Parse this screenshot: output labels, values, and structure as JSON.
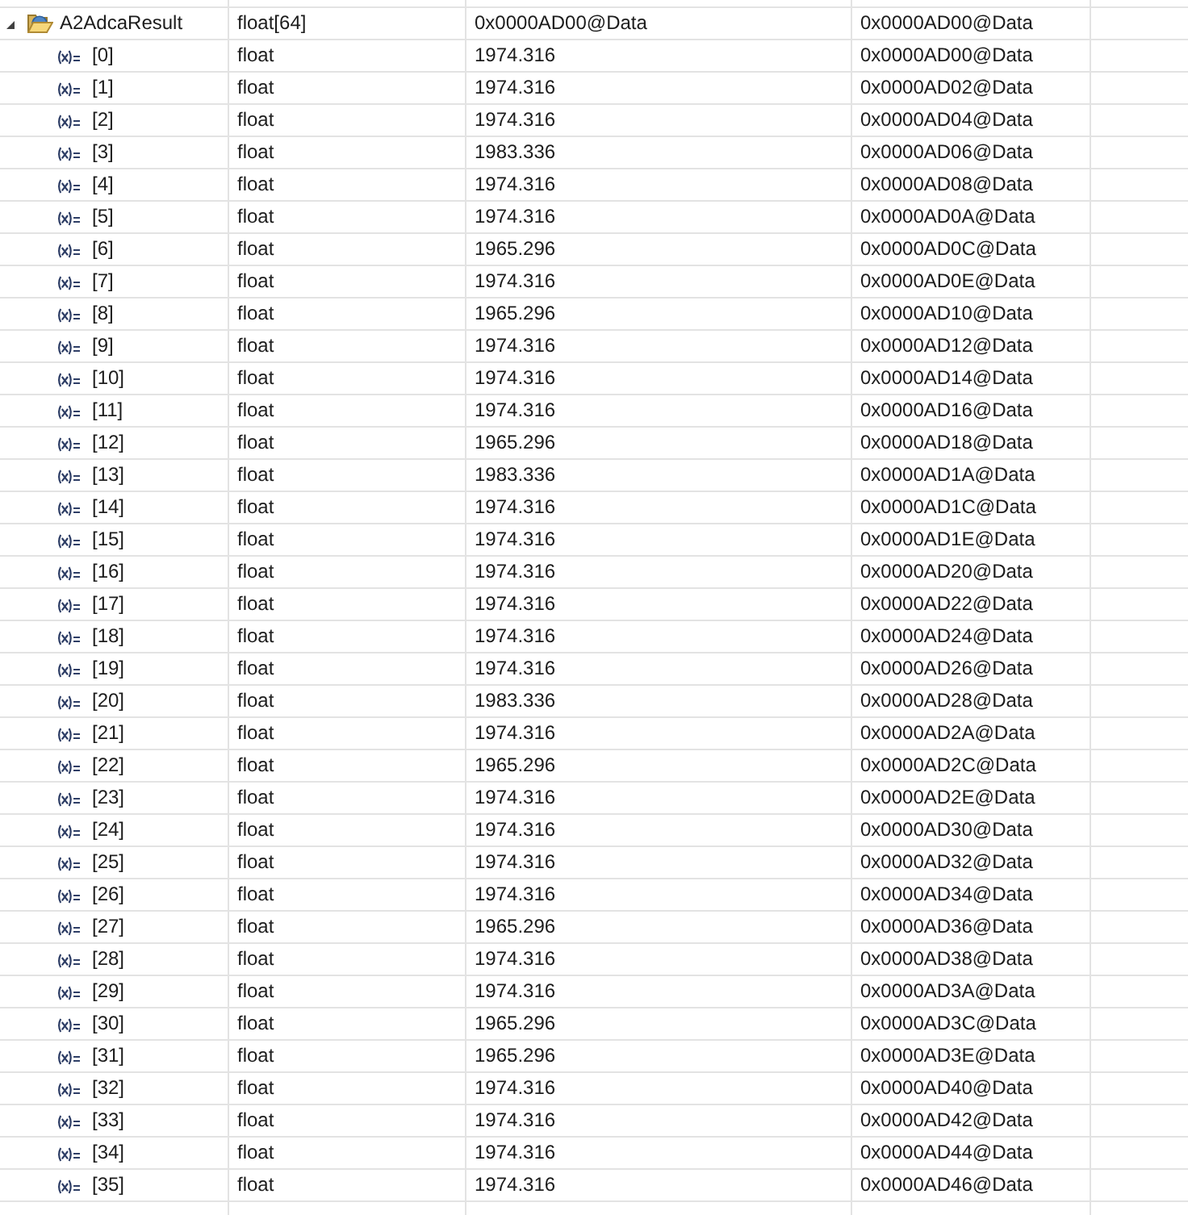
{
  "tree": {
    "items": [
      {
        "kind": "array",
        "expanded": true,
        "cells": [
          "A2AdcaResult",
          "float[64]",
          "0x0000AD00@Data",
          "0x0000AD00@Data"
        ],
        "children": [
          {
            "kind": "variable",
            "cells": [
              "[0]",
              "float",
              "1974.316",
              "0x0000AD00@Data"
            ]
          },
          {
            "kind": "variable",
            "cells": [
              "[1]",
              "float",
              "1974.316",
              "0x0000AD02@Data"
            ]
          },
          {
            "kind": "variable",
            "cells": [
              "[2]",
              "float",
              "1974.316",
              "0x0000AD04@Data"
            ]
          },
          {
            "kind": "variable",
            "cells": [
              "[3]",
              "float",
              "1983.336",
              "0x0000AD06@Data"
            ]
          },
          {
            "kind": "variable",
            "cells": [
              "[4]",
              "float",
              "1974.316",
              "0x0000AD08@Data"
            ]
          },
          {
            "kind": "variable",
            "cells": [
              "[5]",
              "float",
              "1974.316",
              "0x0000AD0A@Data"
            ]
          },
          {
            "kind": "variable",
            "cells": [
              "[6]",
              "float",
              "1965.296",
              "0x0000AD0C@Data"
            ]
          },
          {
            "kind": "variable",
            "cells": [
              "[7]",
              "float",
              "1974.316",
              "0x0000AD0E@Data"
            ]
          },
          {
            "kind": "variable",
            "cells": [
              "[8]",
              "float",
              "1965.296",
              "0x0000AD10@Data"
            ]
          },
          {
            "kind": "variable",
            "cells": [
              "[9]",
              "float",
              "1974.316",
              "0x0000AD12@Data"
            ]
          },
          {
            "kind": "variable",
            "cells": [
              "[10]",
              "float",
              "1974.316",
              "0x0000AD14@Data"
            ]
          },
          {
            "kind": "variable",
            "cells": [
              "[11]",
              "float",
              "1974.316",
              "0x0000AD16@Data"
            ]
          },
          {
            "kind": "variable",
            "cells": [
              "[12]",
              "float",
              "1965.296",
              "0x0000AD18@Data"
            ]
          },
          {
            "kind": "variable",
            "cells": [
              "[13]",
              "float",
              "1983.336",
              "0x0000AD1A@Data"
            ]
          },
          {
            "kind": "variable",
            "cells": [
              "[14]",
              "float",
              "1974.316",
              "0x0000AD1C@Data"
            ]
          },
          {
            "kind": "variable",
            "cells": [
              "[15]",
              "float",
              "1974.316",
              "0x0000AD1E@Data"
            ]
          },
          {
            "kind": "variable",
            "cells": [
              "[16]",
              "float",
              "1974.316",
              "0x0000AD20@Data"
            ]
          },
          {
            "kind": "variable",
            "cells": [
              "[17]",
              "float",
              "1974.316",
              "0x0000AD22@Data"
            ]
          },
          {
            "kind": "variable",
            "cells": [
              "[18]",
              "float",
              "1974.316",
              "0x0000AD24@Data"
            ]
          },
          {
            "kind": "variable",
            "cells": [
              "[19]",
              "float",
              "1974.316",
              "0x0000AD26@Data"
            ]
          },
          {
            "kind": "variable",
            "cells": [
              "[20]",
              "float",
              "1983.336",
              "0x0000AD28@Data"
            ]
          },
          {
            "kind": "variable",
            "cells": [
              "[21]",
              "float",
              "1974.316",
              "0x0000AD2A@Data"
            ]
          },
          {
            "kind": "variable",
            "cells": [
              "[22]",
              "float",
              "1965.296",
              "0x0000AD2C@Data"
            ]
          },
          {
            "kind": "variable",
            "cells": [
              "[23]",
              "float",
              "1974.316",
              "0x0000AD2E@Data"
            ]
          },
          {
            "kind": "variable",
            "cells": [
              "[24]",
              "float",
              "1974.316",
              "0x0000AD30@Data"
            ]
          },
          {
            "kind": "variable",
            "cells": [
              "[25]",
              "float",
              "1974.316",
              "0x0000AD32@Data"
            ]
          },
          {
            "kind": "variable",
            "cells": [
              "[26]",
              "float",
              "1974.316",
              "0x0000AD34@Data"
            ]
          },
          {
            "kind": "variable",
            "cells": [
              "[27]",
              "float",
              "1965.296",
              "0x0000AD36@Data"
            ]
          },
          {
            "kind": "variable",
            "cells": [
              "[28]",
              "float",
              "1974.316",
              "0x0000AD38@Data"
            ]
          },
          {
            "kind": "variable",
            "cells": [
              "[29]",
              "float",
              "1974.316",
              "0x0000AD3A@Data"
            ]
          },
          {
            "kind": "variable",
            "cells": [
              "[30]",
              "float",
              "1965.296",
              "0x0000AD3C@Data"
            ]
          },
          {
            "kind": "variable",
            "cells": [
              "[31]",
              "float",
              "1965.296",
              "0x0000AD3E@Data"
            ]
          },
          {
            "kind": "variable",
            "cells": [
              "[32]",
              "float",
              "1974.316",
              "0x0000AD40@Data"
            ]
          },
          {
            "kind": "variable",
            "cells": [
              "[33]",
              "float",
              "1974.316",
              "0x0000AD42@Data"
            ]
          },
          {
            "kind": "variable",
            "cells": [
              "[34]",
              "float",
              "1974.316",
              "0x0000AD44@Data"
            ]
          },
          {
            "kind": "variable",
            "cells": [
              "[35]",
              "float",
              "1974.316",
              "0x0000AD46@Data"
            ]
          }
        ]
      }
    ]
  }
}
